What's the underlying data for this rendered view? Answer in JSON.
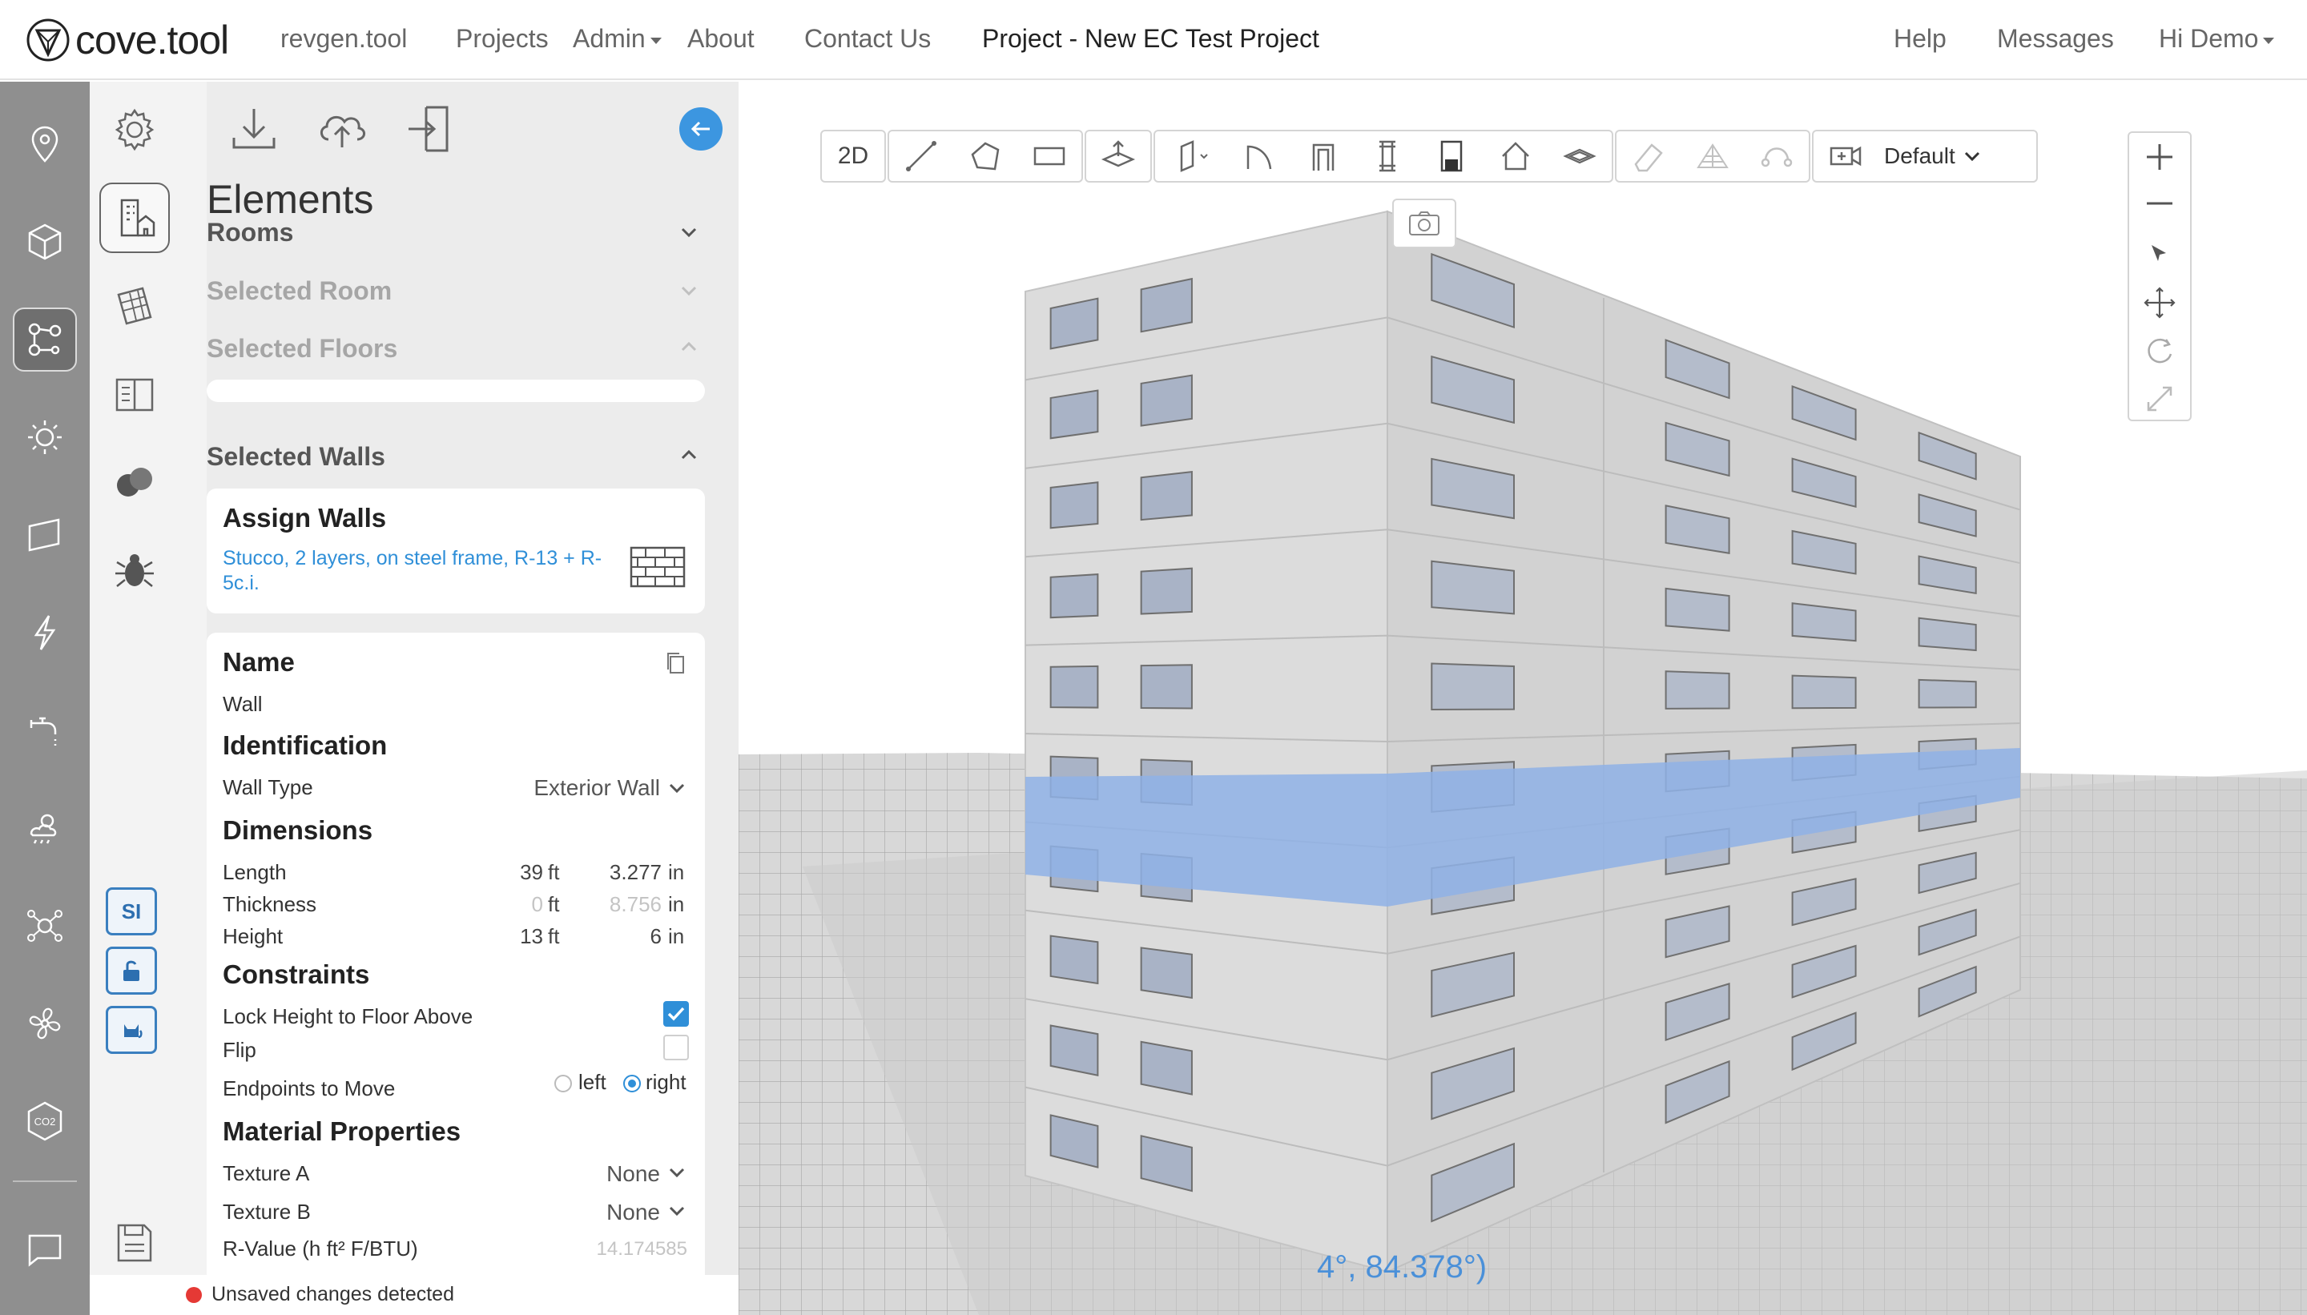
{
  "nav": {
    "brand": "cove.tool",
    "links": [
      "revgen.tool",
      "Projects",
      "Admin",
      "About",
      "Contact Us"
    ],
    "project_title": "Project - New EC Test Project",
    "right_links": [
      "Help",
      "Messages",
      "Hi Demo"
    ]
  },
  "sidebar": {
    "icons": [
      "location-icon",
      "cube-icon",
      "network-icon",
      "sun-icon",
      "surface-icon",
      "lightning-icon",
      "faucet-icon",
      "weather-icon",
      "cost-icon",
      "fan-icon",
      "co2-icon",
      "chat-icon"
    ],
    "co2_label": "CO2",
    "active": "network-icon"
  },
  "tools": {
    "si_label": "SI"
  },
  "panel": {
    "title": "Elements",
    "sections": {
      "rooms": "Rooms",
      "selected_room": "Selected Room",
      "selected_floors": "Selected Floors",
      "selected_walls": "Selected Walls"
    },
    "assign": {
      "title": "Assign Walls",
      "material": "Stucco, 2 layers, on steel frame, R-13 + R-5c.i."
    },
    "props": {
      "name_heading": "Name",
      "name_value": "Wall",
      "identification": "Identification",
      "wall_type_label": "Wall Type",
      "wall_type_value": "Exterior Wall",
      "dimensions": "Dimensions",
      "length_label": "Length",
      "length_ft": "39",
      "length_in": "3.277",
      "thickness_label": "Thickness",
      "thickness_ft": "0",
      "thickness_in": "8.756",
      "height_label": "Height",
      "height_ft": "13",
      "height_in": "6",
      "ft": "ft",
      "in": "in",
      "constraints": "Constraints",
      "lock_label": "Lock Height to Floor Above",
      "lock_checked": true,
      "flip_label": "Flip",
      "flip_checked": false,
      "endpoints_label": "Endpoints to Move",
      "endpoint_left": "left",
      "endpoint_right": "right",
      "endpoint_selected": "right",
      "material_props": "Material Properties",
      "texture_a_label": "Texture A",
      "texture_a_value": "None",
      "texture_b_label": "Texture B",
      "texture_b_value": "None",
      "rvalue_label": "R-Value (h ft² F/BTU)",
      "rvalue_value": "14.174585"
    }
  },
  "status": {
    "message": "Unsaved changes detected",
    "color": "#e53935"
  },
  "viewport": {
    "toolbar_2d": "2D",
    "view_preset": "Default",
    "coord_text": "4°, 84.378°)",
    "selection_color": "#8fb2e6"
  }
}
